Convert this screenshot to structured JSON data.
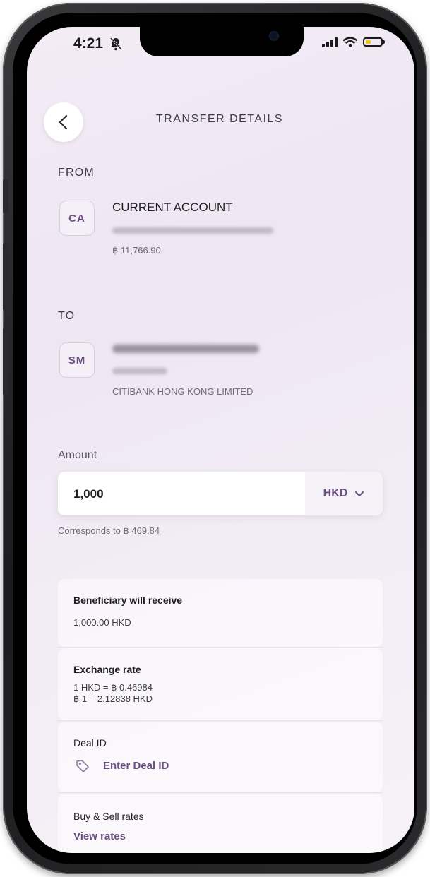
{
  "status_bar": {
    "time": "4:21",
    "icons": [
      "bell-muted-icon",
      "signal-icon",
      "wifi-icon",
      "battery-low-icon"
    ]
  },
  "header": {
    "back_icon": "chevron-left-icon",
    "title": "TRANSFER DETAILS"
  },
  "from": {
    "label": "FROM",
    "badge": "CA",
    "account_name": "CURRENT ACCOUNT",
    "balance": "฿ 11,766.90"
  },
  "to": {
    "label": "TO",
    "badge": "SM",
    "bank_name": "CITIBANK  HONG KONG  LIMITED"
  },
  "amount": {
    "label": "Amount",
    "value": "1,000",
    "currency": "HKD",
    "corresponds": "Corresponds to ฿ 469.84"
  },
  "details": {
    "beneficiary_title": "Beneficiary will receive",
    "beneficiary_value": "1,000.00 HKD",
    "exchange_title": "Exchange rate",
    "exchange_line1": "1 HKD = ฿ 0.46984",
    "exchange_line2": "฿ 1 = 2.12838 HKD",
    "deal_title": "Deal ID",
    "deal_link": "Enter Deal ID",
    "rates_title": "Buy & Sell rates",
    "rates_link": "View rates"
  },
  "colors": {
    "accent": "#6b4e82",
    "background": "#f1ebf4"
  }
}
